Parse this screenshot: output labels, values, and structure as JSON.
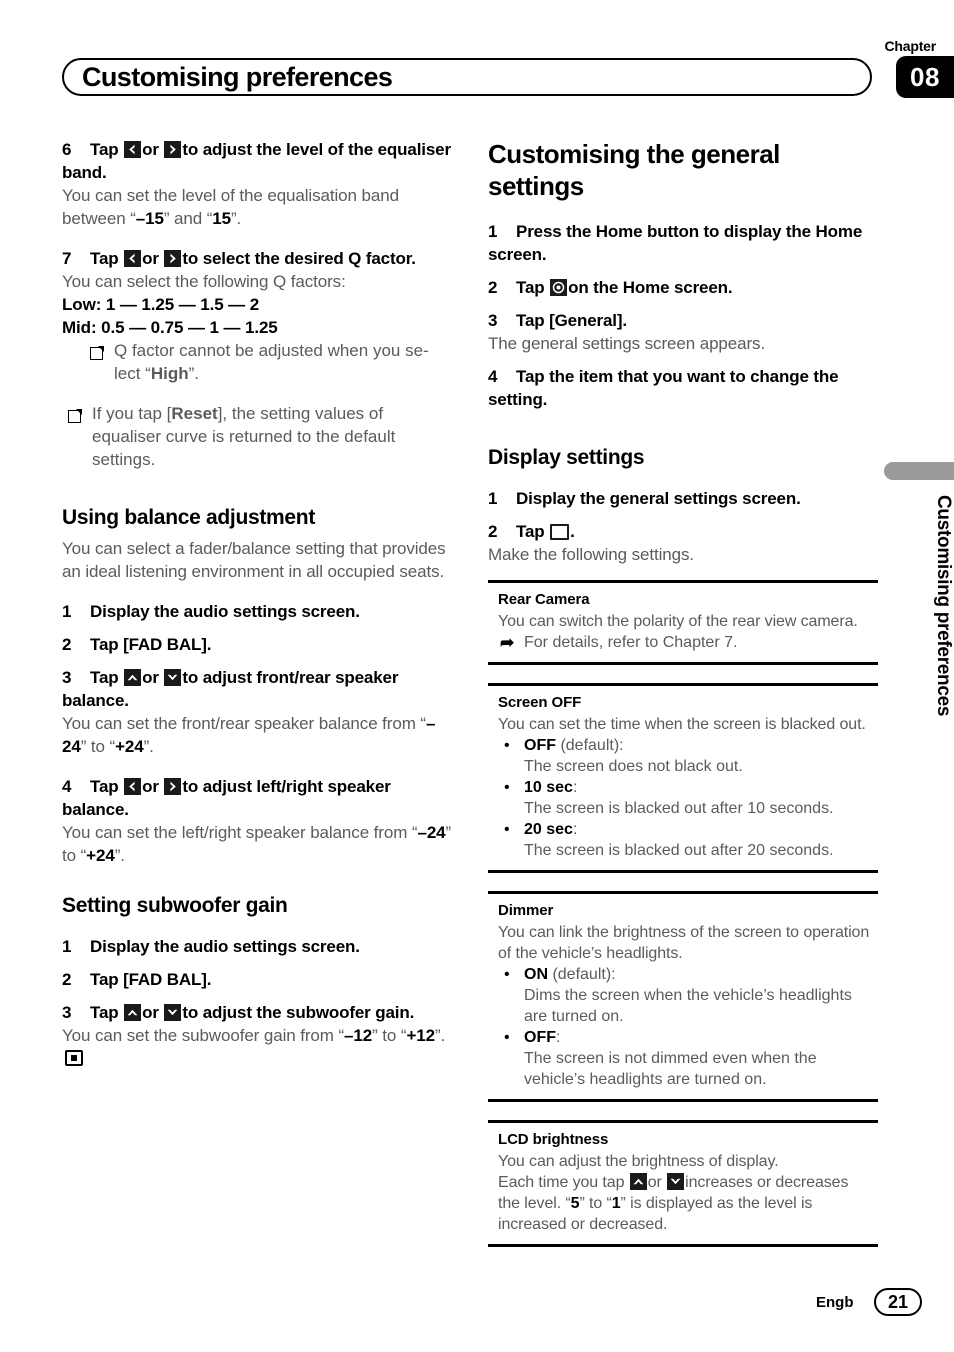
{
  "header": {
    "chapter_label": "Chapter",
    "chapter_number": "08",
    "title": "Customising preferences"
  },
  "side_tab": {
    "text": "Customising preferences"
  },
  "left_column": {
    "step6": {
      "num": "6",
      "text_before": "Tap",
      "text_middle": "or",
      "text_after": "to adjust the level of the equaliser band.",
      "icon_left": "chevron-left-icon",
      "icon_right": "chevron-right-icon",
      "body_1": "You can set the level of the equalisation band between “",
      "body_val_1": "–15",
      "body_2": "” and “",
      "body_val_2": "15",
      "body_3": "”."
    },
    "step7": {
      "num": "7",
      "text_before": "Tap",
      "text_middle": "or",
      "text_after": "to select the desired Q factor.",
      "body_1": "You can select the following Q factors:",
      "low_label": "Low",
      "low_values": ": 1 — 1.25 — 1.5 — 2",
      "mid_label": "Mid",
      "mid_values": ": 0.5 — 0.75 — 1 — 1.25",
      "note_1a": "Q factor cannot be adjusted when you se-lect “",
      "note_1b": "High",
      "note_1c": "”."
    },
    "note_reset": {
      "part_a": "If you tap [",
      "part_b": "Reset",
      "part_c": "], the setting values of equaliser curve is returned to the default settings."
    },
    "balance_section": {
      "heading": "Using balance adjustment",
      "intro": "You can select a fader/balance setting that provides an ideal listening environment in all occupied seats.",
      "steps": [
        {
          "num": "1",
          "text": "Display the audio settings screen."
        },
        {
          "num": "2",
          "text": "Tap [FAD BAL]."
        }
      ],
      "step3": {
        "num": "3",
        "text_before": "Tap",
        "text_middle": "or",
        "text_after": "to adjust front/rear speaker balance.",
        "icon_up": "chevron-up-icon",
        "icon_down": "chevron-down-icon",
        "body_1": "You can set the front/rear speaker balance from “",
        "body_val_1": "–24",
        "body_2": "” to “",
        "body_val_2": "+24",
        "body_3": "”."
      },
      "step4": {
        "num": "4",
        "text_before": "Tap",
        "text_middle": "or",
        "text_after": "to adjust left/right speaker balance.",
        "body_1": "You can set the left/right speaker balance from “",
        "body_val_1": "–24",
        "body_2": "” to “",
        "body_val_2": "+24",
        "body_3": "”."
      }
    },
    "subwoofer_section": {
      "heading": "Setting subwoofer gain",
      "steps": [
        {
          "num": "1",
          "text": "Display the audio settings screen."
        },
        {
          "num": "2",
          "text": "Tap [FAD BAL]."
        }
      ],
      "step3": {
        "num": "3",
        "text_before": "Tap",
        "text_middle": "or",
        "text_after": "to adjust the subwoofer gain.",
        "body_1": "You can set the subwoofer gain from “",
        "body_val_1": "–12",
        "body_2": "” to “",
        "body_val_2": "+12",
        "body_3": "”."
      }
    }
  },
  "right_column": {
    "general_section": {
      "heading": "Customising the general settings",
      "step1": {
        "num": "1",
        "text": "Press the Home button to display the Home screen."
      },
      "step2": {
        "num": "2",
        "text_before": "Tap",
        "text_after": "on the Home screen.",
        "icon": "settings-gear-icon"
      },
      "step3": {
        "num": "3",
        "text": "Tap [General]."
      },
      "step3_body": "The general settings screen appears.",
      "step4": {
        "num": "4",
        "text": "Tap the item that you want to change the setting."
      }
    },
    "display_section": {
      "heading": "Display settings",
      "step1": {
        "num": "1",
        "text": "Display the general settings screen."
      },
      "step2": {
        "num": "2",
        "text_before": "Tap",
        "text_after": ".",
        "icon": "display-monitor-icon"
      },
      "step2_body": "Make the following settings.",
      "settings": [
        {
          "title": "Rear Camera",
          "desc": "You can switch the polarity of the rear view camera.",
          "ref": "For details, refer to Chapter 7.",
          "ref_icon": "reference-arrow-icon",
          "options": []
        },
        {
          "title": "Screen OFF",
          "desc": "You can set the time when the screen is blacked out.",
          "options": [
            {
              "label": "OFF",
              "suffix": " (default):",
              "detail": "The screen does not black out."
            },
            {
              "label": "10 sec",
              "suffix": ":",
              "detail": "The screen is blacked out after 10 seconds."
            },
            {
              "label": "20 sec",
              "suffix": ":",
              "detail": "The screen is blacked out after 20 seconds."
            }
          ]
        },
        {
          "title": "Dimmer",
          "desc": "You can link the brightness of the screen to operation of the vehicle’s headlights.",
          "options": [
            {
              "label": "ON",
              "suffix": " (default):",
              "detail": "Dims the screen when the vehicle’s headlights are turned on."
            },
            {
              "label": "OFF",
              "suffix": ":",
              "detail": "The screen is not dimmed even when the vehicle’s headlights are turned on."
            }
          ]
        },
        {
          "title": "LCD brightness",
          "desc": "You can adjust the brightness of display.",
          "desc2_a": "Each time you tap",
          "desc2_b": "or",
          "desc2_c": "increases or decreases the level. “",
          "desc2_val1": "5",
          "desc2_d": "” to “",
          "desc2_val2": "1",
          "desc2_e": "” is displayed as the level is increased or decreased.",
          "options": []
        }
      ]
    }
  },
  "footer": {
    "language": "Engb",
    "page_number": "21"
  }
}
